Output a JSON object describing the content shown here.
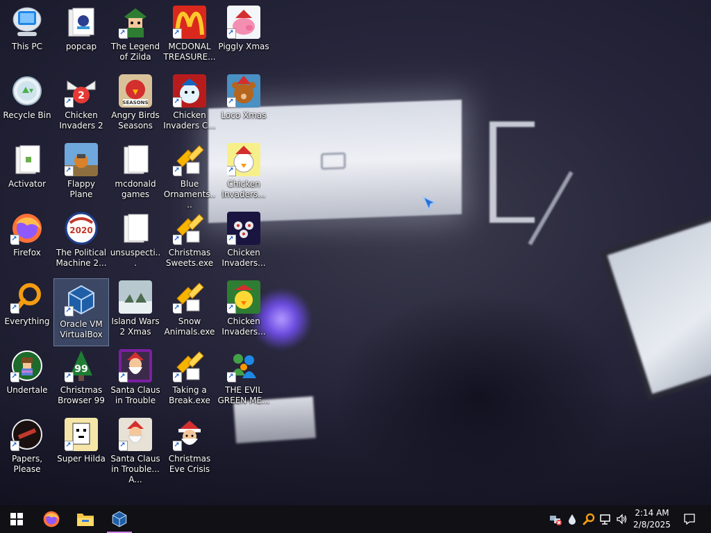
{
  "desktop": {
    "icons": [
      {
        "label": "This PC"
      },
      {
        "label": "Recycle Bin"
      },
      {
        "label": "Activator"
      },
      {
        "label": "Firefox"
      },
      {
        "label": "Everything"
      },
      {
        "label": "Undertale"
      },
      {
        "label": "Papers, Please"
      },
      {
        "label": "popcap"
      },
      {
        "label": "Chicken Invaders 2"
      },
      {
        "label": "Flappy Plane"
      },
      {
        "label": "The Political Machine 2..."
      },
      {
        "label": "Oracle VM VirtualBox"
      },
      {
        "label": "Christmas Browser 99"
      },
      {
        "label": "Super Hilda"
      },
      {
        "label": "The Legend of Zilda"
      },
      {
        "label": "Angry Birds Seasons"
      },
      {
        "label": "mcdonald games"
      },
      {
        "label": "unsuspecti..."
      },
      {
        "label": "Island Wars 2 Xmas"
      },
      {
        "label": "Santa Claus in Trouble"
      },
      {
        "label": "Santa Claus in Trouble... A..."
      },
      {
        "label": "MCDONAL TREASURE..."
      },
      {
        "label": "Chicken Invaders C..."
      },
      {
        "label": "Blue Ornaments...."
      },
      {
        "label": "Christmas Sweets.exe"
      },
      {
        "label": "Snow Animals.exe"
      },
      {
        "label": "Taking a Break.exe"
      },
      {
        "label": "Christmas Eve Crisis"
      },
      {
        "label": "Piggly Xmas"
      },
      {
        "label": "Loco Xmas"
      },
      {
        "label": "Chicken Invaders..."
      },
      {
        "label": "Chicken Invaders..."
      },
      {
        "label": "Chicken Invaders..."
      },
      {
        "label": "THE EVIL GREEN ME..."
      }
    ],
    "badges": {
      "chicken2": "2",
      "political": "2020",
      "browser99": "99",
      "angry": "SEASONS"
    }
  },
  "taskbar": {
    "apps": [
      "Firefox",
      "File Explorer",
      "Oracle VM VirtualBox"
    ],
    "clock": {
      "time": "2:14 AM",
      "date": "2/8/2025"
    },
    "accent": "#d58bf0"
  }
}
